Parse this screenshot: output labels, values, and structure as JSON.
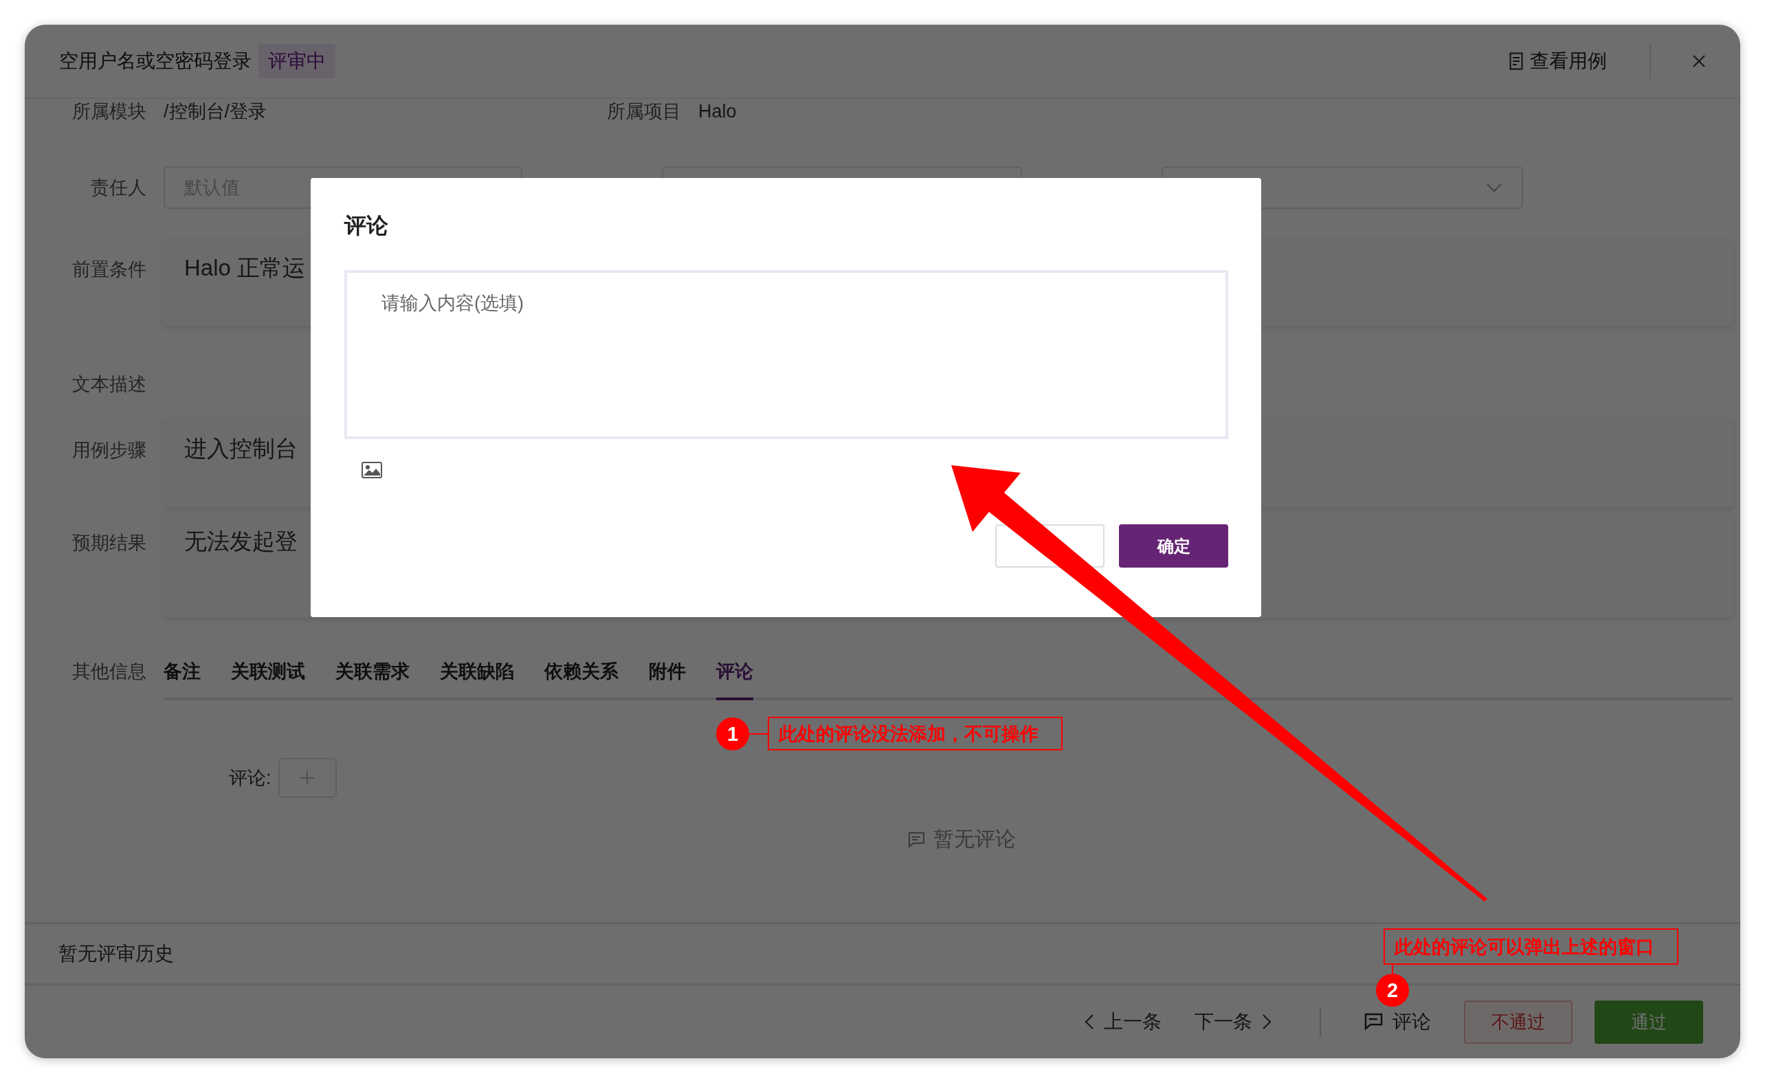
{
  "window": {
    "title": "空用户名或空密码登录",
    "status_badge": "评审中",
    "view_case_link": "查看用例"
  },
  "fields": [
    {
      "label": "所属模块",
      "value": "/控制台/登录"
    },
    {
      "label": "所属项目",
      "value": "Halo"
    }
  ],
  "assignee": {
    "label": "责任人",
    "placeholder": "默认值"
  },
  "sections": [
    {
      "label": "前置条件",
      "kind": "card",
      "content": "Halo 正常运"
    },
    {
      "label": "文本描述",
      "kind": "plain"
    },
    {
      "label": "用例步骤",
      "kind": "card",
      "content": "进入控制台"
    },
    {
      "label": "预期结果",
      "kind": "card",
      "content": "无法发起登"
    }
  ],
  "other_info": {
    "label": "其他信息",
    "tabs": [
      {
        "label": "备注",
        "selected": false
      },
      {
        "label": "关联测试",
        "selected": false
      },
      {
        "label": "关联需求",
        "selected": false
      },
      {
        "label": "关联缺陷",
        "selected": false
      },
      {
        "label": "依赖关系",
        "selected": false
      },
      {
        "label": "附件",
        "selected": false
      },
      {
        "label": "评论",
        "selected": true
      }
    ],
    "comment_label": "评论:",
    "empty_text": "暂无评论"
  },
  "review_history": "暂无评审历史",
  "footer": {
    "prev": "上一条",
    "next": "下一条",
    "comment": "评论",
    "reject": "不通过",
    "approve": "通过"
  },
  "modal": {
    "title": "评论",
    "textarea": {
      "placeholder": "请输入内容(选填)"
    },
    "confirm": "确定"
  },
  "annotations": [
    {
      "number": "1",
      "text": "此处的评论没法添加，不可操作"
    },
    {
      "number": "2",
      "text": "此处的评论可以弹出上述的窗口"
    }
  ]
}
